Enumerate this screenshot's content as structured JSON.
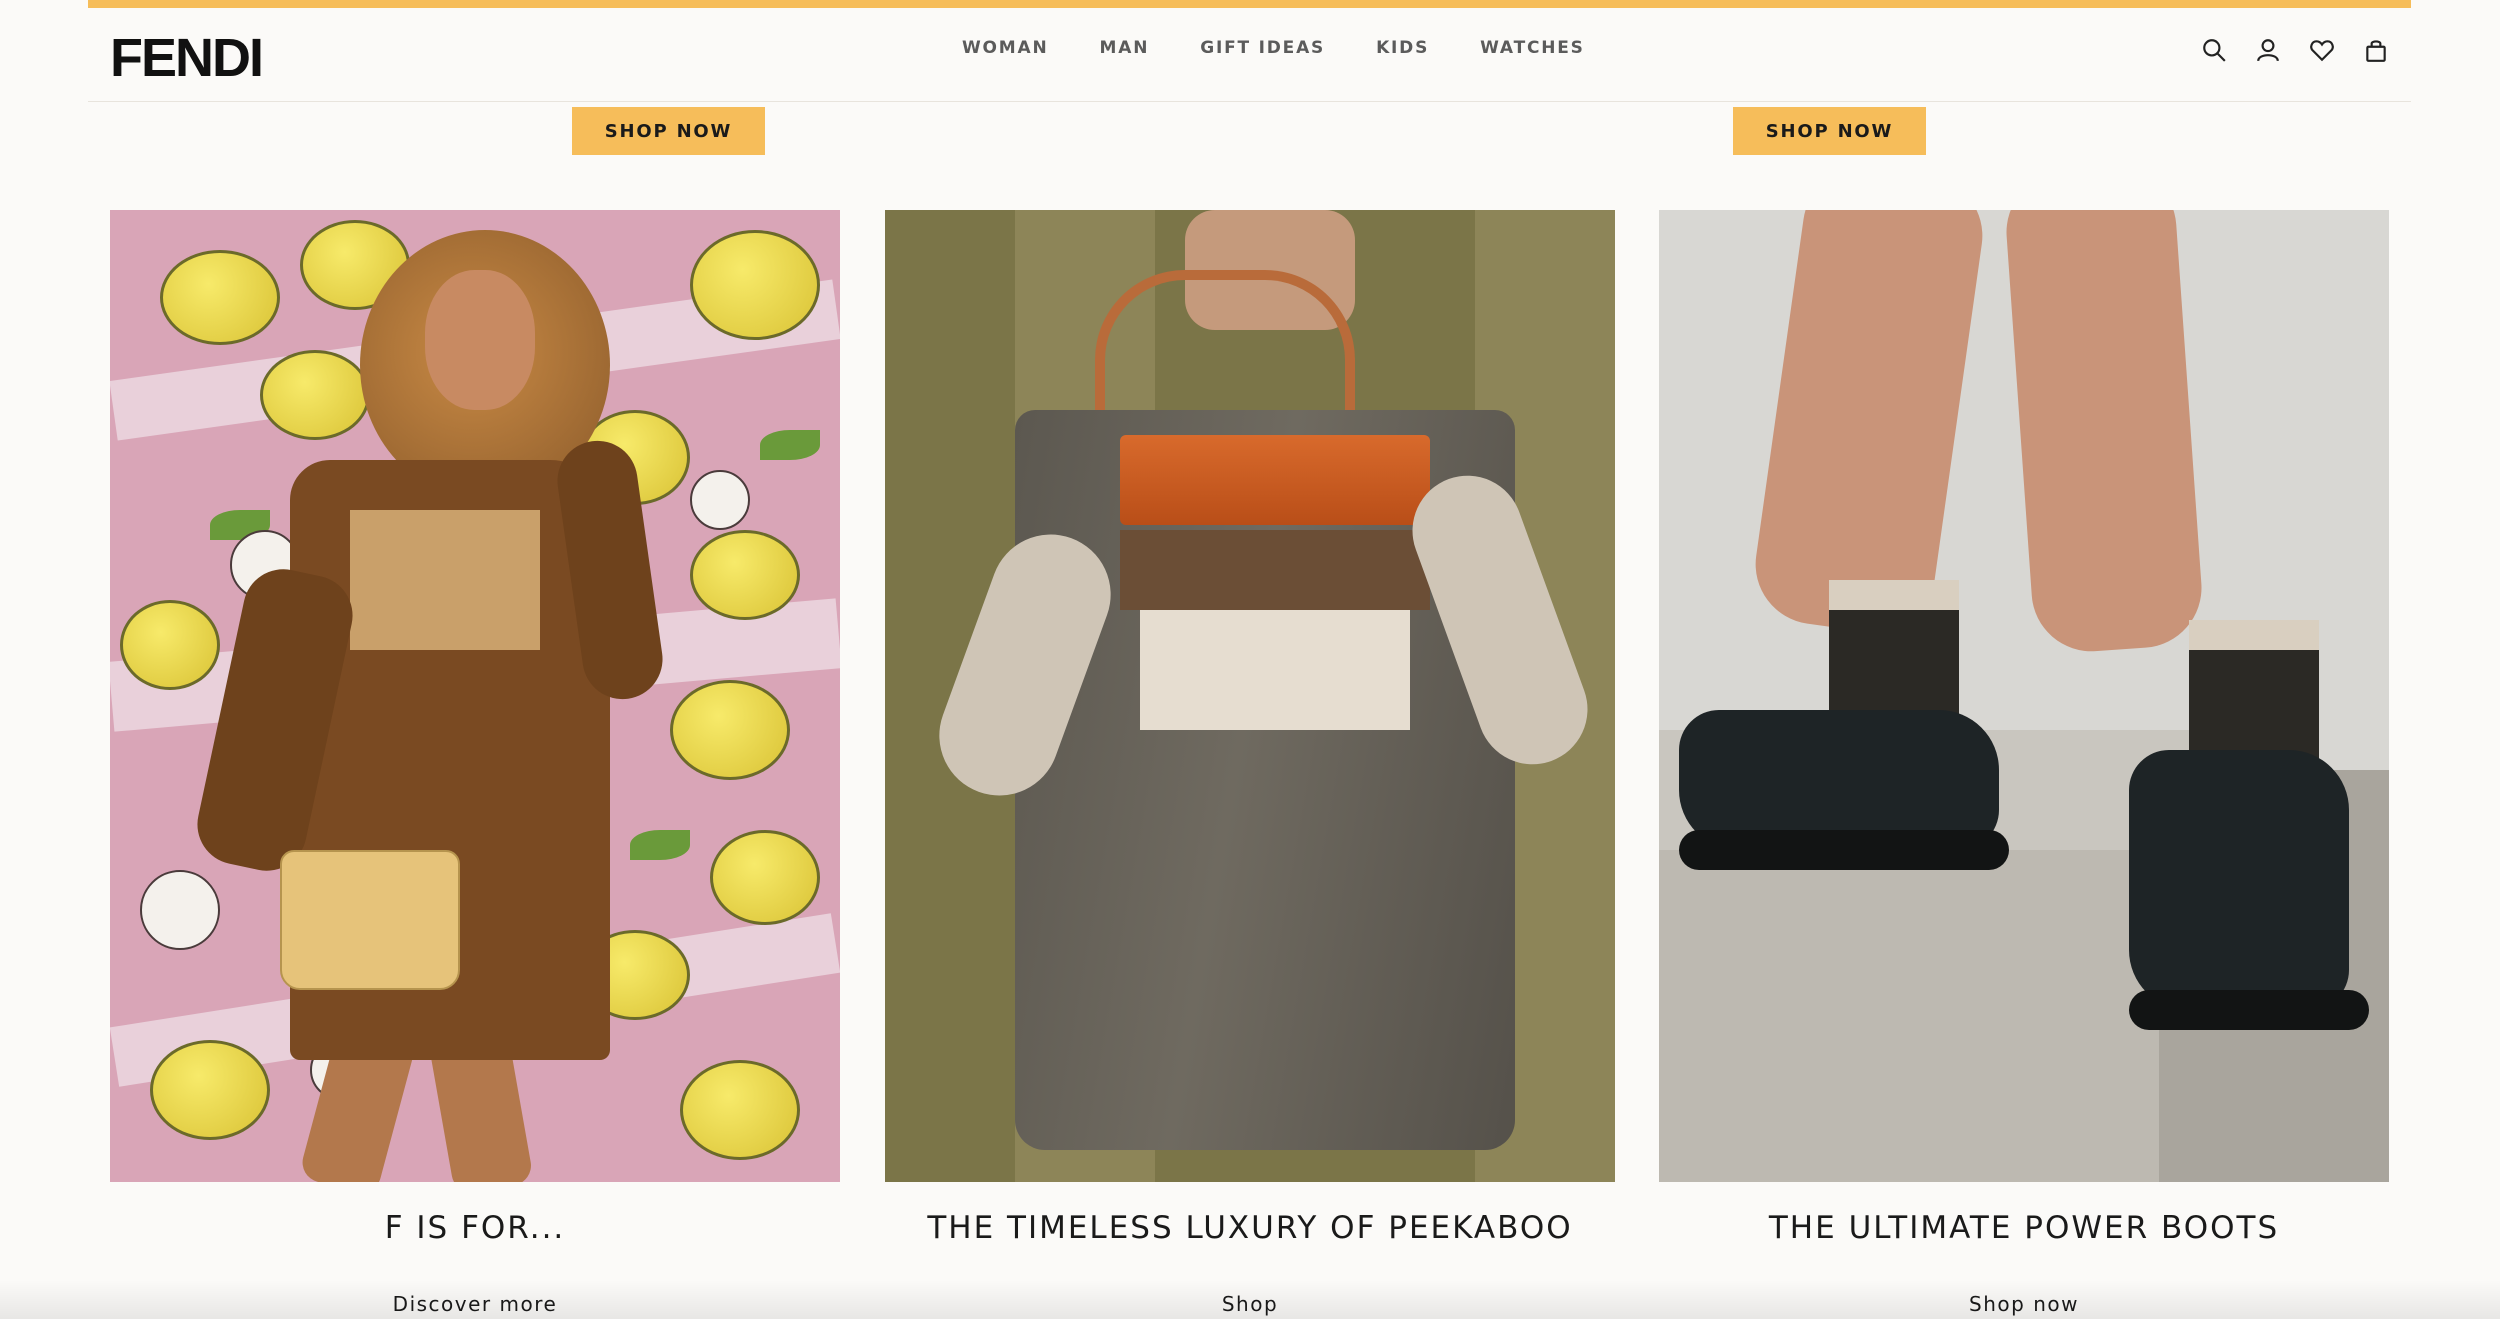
{
  "brand": {
    "logo_text": "FENDI",
    "accent_color": "#f6bd5a"
  },
  "nav": {
    "items": [
      {
        "label": "WOMAN"
      },
      {
        "label": "MAN"
      },
      {
        "label": "GIFT IDEAS"
      },
      {
        "label": "KIDS"
      },
      {
        "label": "WATCHES"
      }
    ]
  },
  "header_icons": [
    "search-icon",
    "account-icon",
    "wishlist-heart-icon",
    "shopping-bag-icon"
  ],
  "promo_buttons": {
    "left_label": "SHOP NOW",
    "right_label": "SHOP NOW"
  },
  "cards": [
    {
      "title": "F IS FOR...",
      "link_label": "Discover more"
    },
    {
      "title": "THE TIMELESS LUXURY OF PEEKABOO",
      "link_label": "Shop"
    },
    {
      "title": "THE ULTIMATE POWER BOOTS",
      "link_label": "Shop now"
    }
  ]
}
